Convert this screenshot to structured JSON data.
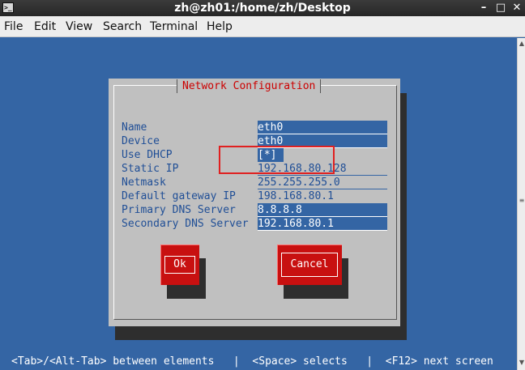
{
  "window": {
    "title": "zh@zh01:/home/zh/Desktop",
    "terminal_icon": "terminal-icon",
    "minimize_label": "–",
    "maximize_label": "□",
    "close_label": "✕"
  },
  "menubar": {
    "items": [
      "File",
      "Edit",
      "View",
      "Search",
      "Terminal",
      "Help"
    ]
  },
  "scrollbar": {
    "up": "▲",
    "down": "▼",
    "mid": "≡"
  },
  "dialog": {
    "title": "Network Configuration",
    "fields": [
      {
        "label": "Name",
        "value": "eth0"
      },
      {
        "label": "Device",
        "value": "eth0"
      },
      {
        "label": "Use DHCP",
        "value": "[*]"
      },
      {
        "label": "Static IP",
        "value": "192.168.80.128"
      },
      {
        "label": "Netmask",
        "value": "255.255.255.0"
      },
      {
        "label": "Default gateway IP",
        "value": "198.168.80.1"
      },
      {
        "label": "Primary DNS Server",
        "value": "8.8.8.8"
      },
      {
        "label": "Secondary DNS Server",
        "value": "192.168.80.1"
      }
    ],
    "ok_label": "Ok",
    "cancel_label": "Cancel"
  },
  "statusline": "<Tab>/<Alt-Tab> between elements   |  <Space> selects   |  <F12> next screen",
  "colors": {
    "background": "#3465a4",
    "dialog": "#c0c0c0",
    "title_text": "#cc0000",
    "label_text": "#1f4e96",
    "button": "#c81010",
    "highlight_box": "#e02020"
  }
}
